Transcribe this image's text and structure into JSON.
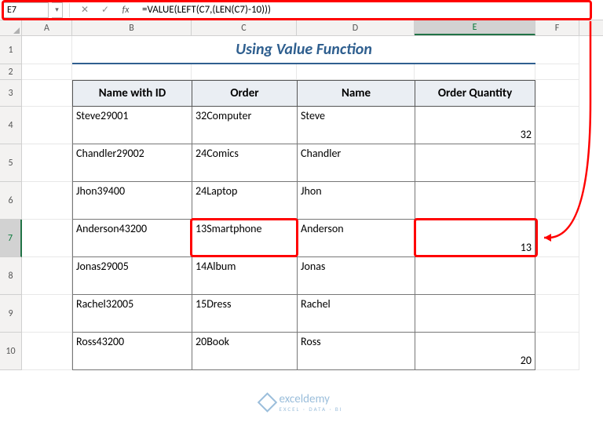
{
  "namebox": "E7",
  "formula": "=VALUE(LEFT(C7,(LEN(C7)-10)))",
  "columns": [
    "A",
    "B",
    "C",
    "D",
    "E",
    "F"
  ],
  "rows": [
    "1",
    "2",
    "3",
    "4",
    "5",
    "6",
    "7",
    "8",
    "9",
    "10"
  ],
  "title": "Using Value Function",
  "headers": {
    "b": "Name with ID",
    "c": "Order",
    "d": "Name",
    "e": "Order Quantity"
  },
  "data": [
    {
      "b": "Steve29001",
      "c": "32Computer",
      "d": "Steve",
      "e": "32"
    },
    {
      "b": "Chandler29002",
      "c": "24Comics",
      "d": "Chandler",
      "e": ""
    },
    {
      "b": "Jhon39400",
      "c": "24Laptop",
      "d": "Jhon",
      "e": ""
    },
    {
      "b": "Anderson43200",
      "c": "13Smartphone",
      "d": "Anderson",
      "e": "13"
    },
    {
      "b": "Jonas29005",
      "c": "14Album",
      "d": "Jonas",
      "e": ""
    },
    {
      "b": "Rachel32005",
      "c": "15Dress",
      "d": "Rachel",
      "e": ""
    },
    {
      "b": "Ross43200",
      "c": "20Book",
      "d": "Ross",
      "e": "20"
    }
  ],
  "selected_col": "E",
  "selected_row": "7",
  "watermark": {
    "brand": "exceldemy",
    "tag": "EXCEL · DATA · BI"
  }
}
